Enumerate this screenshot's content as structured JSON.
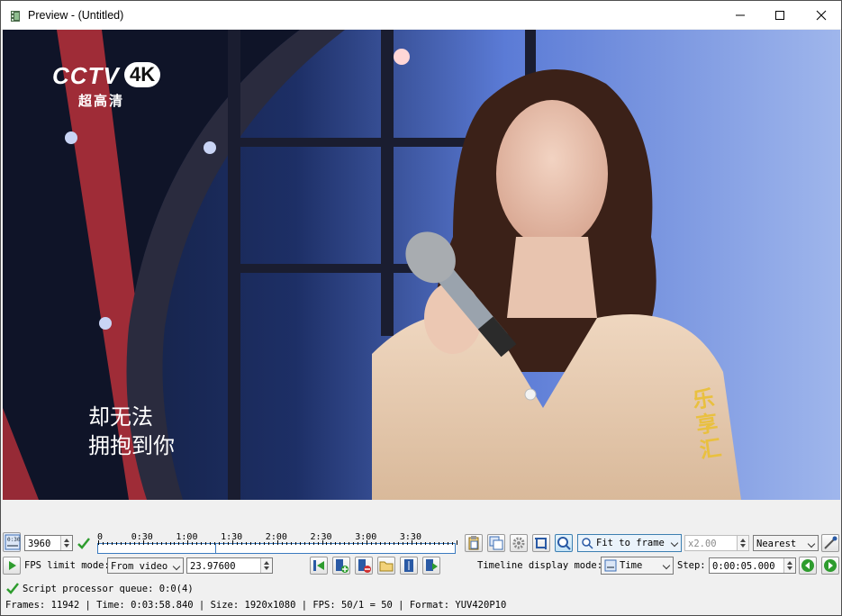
{
  "window": {
    "title": "Preview - (Untitled)"
  },
  "preview": {
    "channel_logo": "CCTV",
    "channel_badge": "4K",
    "channel_subtitle": "超高清",
    "subtitle_line1": "却无法",
    "subtitle_line2": "拥抱到你",
    "watermark": "乐享汇"
  },
  "toolbar": {
    "frame_value": "3960",
    "fps_limit_label": "FPS limit mode:",
    "fps_limit_value": "From video",
    "fps_value": "23.97600",
    "zoom_mode": "Fit to frame",
    "zoom_ratio": "x2.00",
    "scale_mode": "Nearest",
    "timeline_mode_label": "Timeline display mode:",
    "timeline_mode_value": "Time",
    "step_label": "Step:",
    "step_value": "0:00:05.000"
  },
  "timeline": {
    "labels": [
      "0",
      "0:30",
      "1:00",
      "1:30",
      "2:00",
      "2:30",
      "3:00",
      "3:30"
    ]
  },
  "status": {
    "queue": "Script processor queue: 0:0(4)",
    "info": "Frames: 11942 | Time: 0:03:58.840 | Size: 1920x1080 | FPS: 50/1 = 50 | Format: YUV420P10"
  },
  "colors": {
    "accent": "#3b7bbf",
    "check_green": "#2e9c2e"
  }
}
